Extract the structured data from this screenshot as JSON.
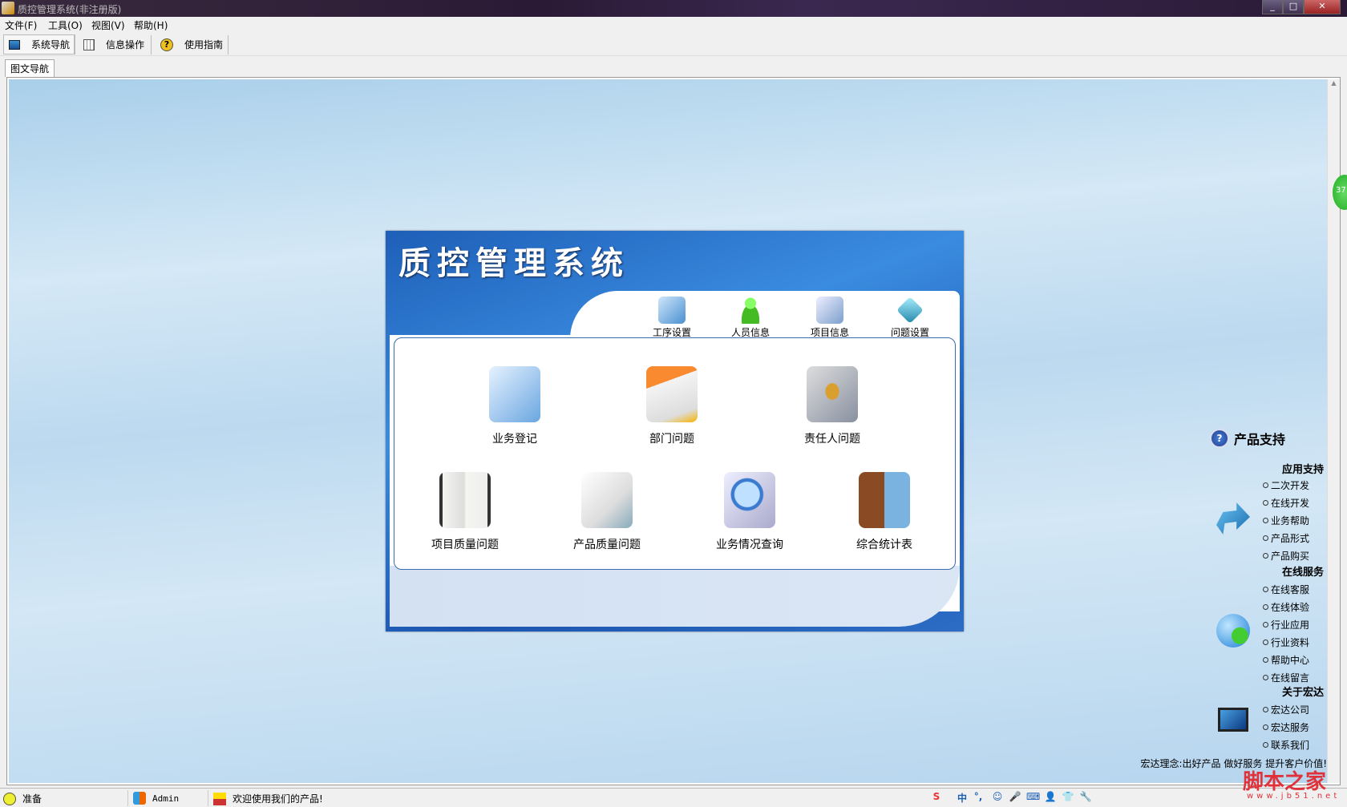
{
  "window": {
    "title": "质控管理系统(非注册版)",
    "min": "_",
    "max": "□",
    "close": "✕"
  },
  "menu": [
    "文件(F)",
    "工具(O)",
    "视图(V)",
    "帮助(H)"
  ],
  "toolbar": [
    "系统导航",
    "信息操作",
    "使用指南"
  ],
  "tab": "图文导航",
  "panel": {
    "title": "质控管理系统",
    "top_items": [
      "工序设置",
      "人员信息",
      "项目信息",
      "问题设置"
    ],
    "row1": [
      "业务登记",
      "部门问题",
      "责任人问题"
    ],
    "row2": [
      "项目质量问题",
      "产品质量问题",
      "业务情况查询",
      "综合统计表"
    ]
  },
  "support": {
    "title": "产品支持",
    "sections": [
      {
        "heading": "应用支持",
        "links": [
          "二次开发",
          "在线开发",
          "业务帮助",
          "产品形式",
          "产品购买"
        ]
      },
      {
        "heading": "在线服务",
        "links": [
          "在线客服",
          "在线体验",
          "行业应用",
          "行业资料",
          "帮助中心",
          "在线留言"
        ]
      },
      {
        "heading": "关于宏达",
        "links": [
          "宏达公司",
          "宏达服务",
          "联系我们"
        ]
      }
    ],
    "slogan": "宏达理念:出好产品 做好服务 提升客户价值!"
  },
  "badge": "37",
  "status": {
    "ready": "准备",
    "user": "Admin",
    "welcome": "欢迎使用我们的产品!"
  },
  "tray": [
    "S",
    "中",
    "°,",
    "☺",
    "🎤",
    "⌨",
    "👤",
    "👕",
    "🔧"
  ],
  "watermark": {
    "logo": "脚本之家",
    "url": "www.jb51.net"
  }
}
